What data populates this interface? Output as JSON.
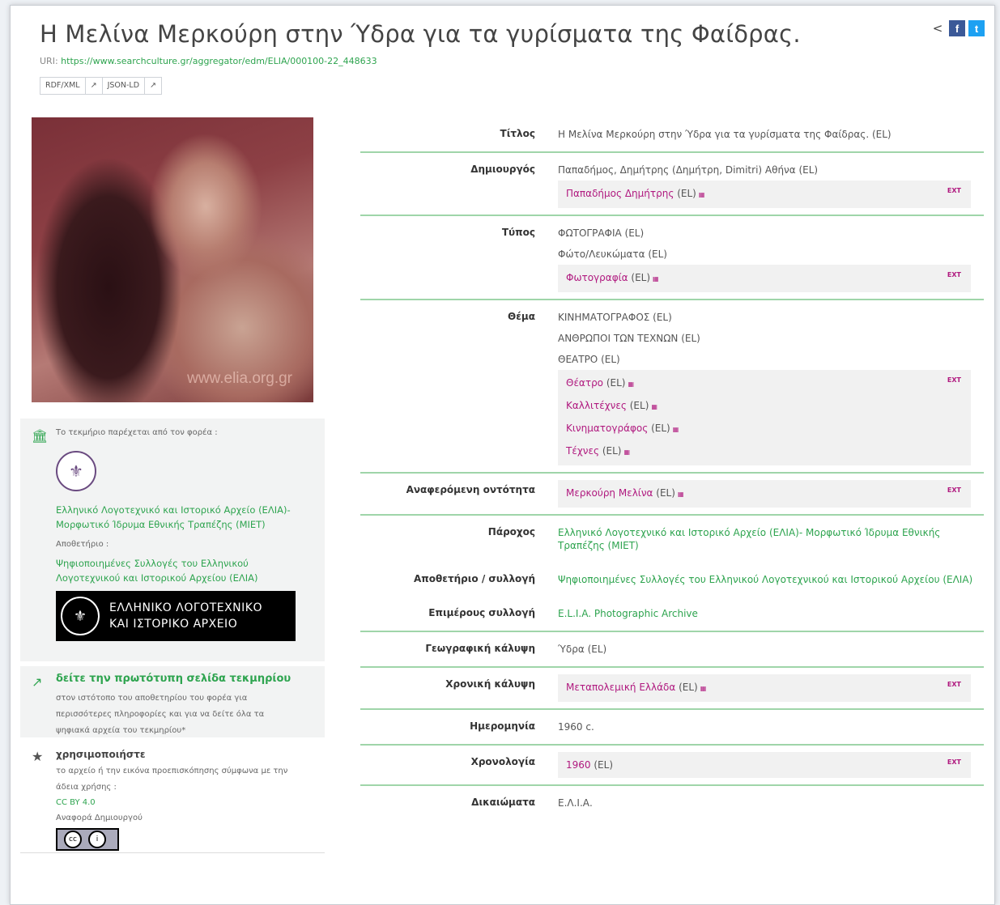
{
  "header": {
    "title": "Η Μελίνα Μερκούρη στην Ύδρα για τα γυρίσματα της Φαίδρας.",
    "uri_label": "URI:",
    "uri": "https://www.searchculture.gr/aggregator/edm/ELIA/000100-22_448633",
    "formats": [
      "RDF/XML",
      "JSON-LD"
    ],
    "share_icons": [
      "share-icon",
      "facebook-icon",
      "twitter-icon"
    ]
  },
  "photo": {
    "watermark": "www.elia.org.gr"
  },
  "provider_panel": {
    "intro": "Το τεκμήριο παρέχεται από τον φορέα :",
    "provider_name": "Ελληνικό Λογοτεχνικό και Ιστορικό Αρχείο (ΕΛΙΑ)- Μορφωτικό Ίδρυμα Εθνικής Τραπέζης (ΜΙΕΤ)",
    "repo_label": "Αποθετήριο :",
    "repo_name": "Ψηφιοποιημένες Συλλογές του Ελληνικού Λογοτεχνικού και Ιστορικού Αρχείου (ΕΛΙΑ)",
    "banner_line1": "ΕΛΛΗΝΙΚΟ ΛΟΓΟΤΕΧΝΙΚΟ",
    "banner_line2": "ΚΑΙ ΙΣΤΟΡΙΚΟ ΑΡΧΕΙΟ"
  },
  "original_panel": {
    "heading": "δείτε την πρωτότυπη σελίδα τεκμηρίου",
    "desc": "στον ιστότοπο του αποθετηρίου του φορέα για περισσότερες πληροφορίες και για να δείτε όλα τα ψηφιακά αρχεία του τεκμηρίου*"
  },
  "use_panel": {
    "heading": "χρησιμοποιήστε",
    "desc": "το αρχείο ή την εικόνα προεπισκόπησης σύμφωνα με την άδεια χρήσης :",
    "license": "CC BY 4.0",
    "attribution": "Αναφορά Δημιουργού"
  },
  "fields": {
    "title_k": "Τίτλος",
    "title_v": "Η Μελίνα Μερκούρη στην Ύδρα για τα γυρίσματα της Φαίδρας. (EL)",
    "creator_k": "Δημιουργός",
    "creator_v": "Παπαδήμος, Δημήτρης (Δημήτρη, Dimitri) Αθήνα (EL)",
    "creator_link": "Παπαδήμος Δημήτρης",
    "type_k": "Τύπος",
    "type_v1": "ΦΩΤΟΓΡΑΦΙΑ (EL)",
    "type_v2": "Φώτο/Λευκώματα (EL)",
    "type_link": "Φωτογραφία",
    "subject_k": "Θέμα",
    "subject_v1": "ΚΙΝΗΜΑΤΟΓΡΑΦΟΣ (EL)",
    "subject_v2": "ΑΝΘΡΩΠΟΙ ΤΩΝ ΤΕΧΝΩΝ (EL)",
    "subject_v3": "ΘΕΑΤΡΟ (EL)",
    "subject_links": [
      "Θέατρο",
      "Καλλιτέχνες",
      "Κινηματογράφος",
      "Τέχνες"
    ],
    "entity_k": "Αναφερόμενη οντότητα",
    "entity_link": "Μερκούρη Μελίνα",
    "provider_k": "Πάροχος",
    "provider_v": "Ελληνικό Λογοτεχνικό και Ιστορικό Αρχείο (ΕΛΙΑ)- Μορφωτικό Ίδρυμα Εθνικής Τραπέζης (ΜΙΕΤ)",
    "repo_k": "Αποθετήριο / συλλογή",
    "repo_v": "Ψηφιοποιημένες Συλλογές του Ελληνικού Λογοτεχνικού και Ιστορικού Αρχείου (ΕΛΙΑ)",
    "subcol_k": "Επιμέρους συλλογή",
    "subcol_v": "E.L.I.A. Photographic Archive",
    "geo_k": "Γεωγραφική κάλυψη",
    "geo_v": "Ύδρα (EL)",
    "temporal_k": "Χρονική κάλυψη",
    "temporal_link": "Μεταπολεμική Ελλάδα",
    "date_k": "Ημερομηνία",
    "date_v": "1960 c.",
    "chrono_k": "Χρονολογία",
    "chrono_link": "1960",
    "rights_k": "Δικαιώματα",
    "rights_v": "E.Λ.Ι.Α.",
    "lang_tag": "(EL)",
    "ext_tag": "EXT"
  }
}
